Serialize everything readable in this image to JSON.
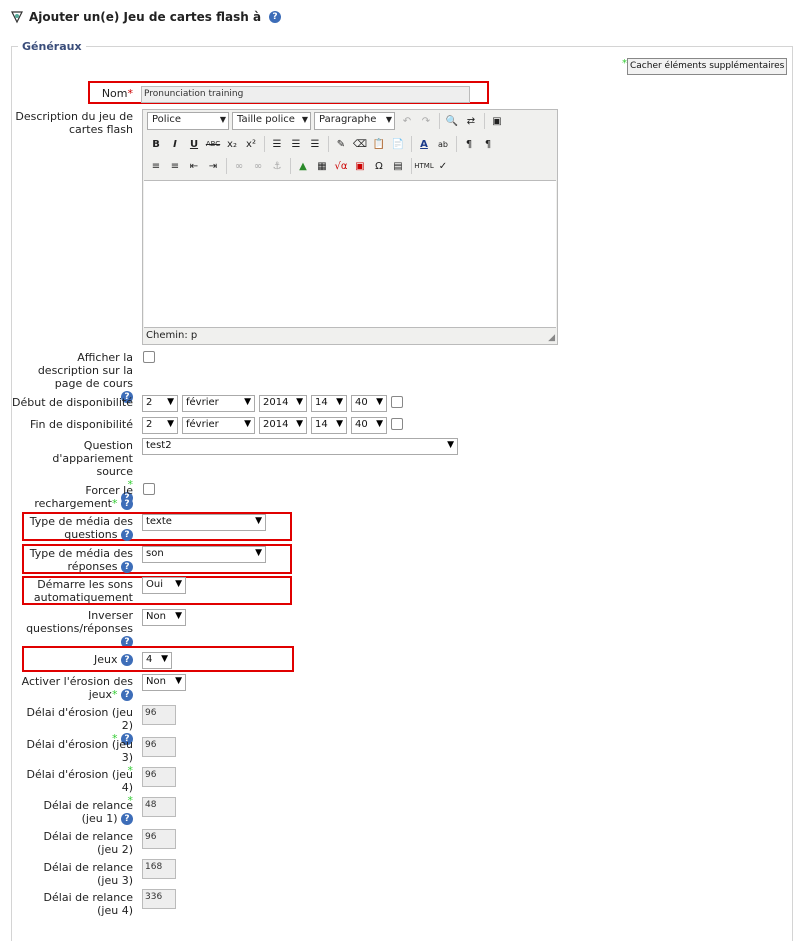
{
  "header": {
    "title": "Ajouter un(e) Jeu de cartes flash à",
    "help": "?"
  },
  "fieldset": {
    "legend": "Généraux"
  },
  "hide_advanced": "Cacher éléments supplémentaires",
  "fields": {
    "name": {
      "label": "Nom",
      "required_mark": "*",
      "value": "Pronunciation training"
    },
    "description": {
      "label": "Description du jeu de cartes flash"
    },
    "show_description": {
      "label": "Afficher la description sur la page de cours"
    },
    "start": {
      "label": "Début de disponibilité",
      "day": "2",
      "month": "février",
      "year": "2014",
      "hour": "14",
      "minute": "40"
    },
    "end": {
      "label": "Fin de disponibilité",
      "day": "2",
      "month": "février",
      "year": "2014",
      "hour": "14",
      "minute": "40"
    },
    "source_question": {
      "label": "Question d'appariement source",
      "value": "test2"
    },
    "force_reload": {
      "label": "Forcer le rechargement"
    },
    "question_media": {
      "label": "Type de média des questions",
      "value": "texte"
    },
    "answer_media": {
      "label": "Type de média des réponses",
      "value": "son"
    },
    "autoplay": {
      "label": "Démarre les sons automatiquement",
      "value": "Oui"
    },
    "invert": {
      "label": "Inverser questions/réponses",
      "value": "Non"
    },
    "decks": {
      "label": "Jeux",
      "value": "4"
    },
    "erosion": {
      "label": "Activer l'érosion des jeux",
      "value": "Non"
    },
    "erosion_delays": [
      {
        "label": "Délai d'érosion (jeu 2)",
        "value": "96"
      },
      {
        "label": "Délai d'érosion (jeu 3)",
        "value": "96"
      },
      {
        "label": "Délai d'érosion (jeu 4)",
        "value": "96"
      }
    ],
    "relaunch_delays": [
      {
        "label": "Délai de relance (jeu 1)",
        "value": "48"
      },
      {
        "label": "Délai de relance (jeu 2)",
        "value": "96"
      },
      {
        "label": "Délai de relance (jeu 3)",
        "value": "168"
      },
      {
        "label": "Délai de relance (jeu 4)",
        "value": "336"
      }
    ]
  },
  "editor": {
    "font_family": "Police",
    "font_size": "Taille police",
    "block_format": "Paragraphe",
    "path": "Chemin: p"
  },
  "colors": {
    "highlight": "#e00000",
    "legend": "#3a4d7a",
    "help": "#3d6db8",
    "required": "#cc0000"
  }
}
